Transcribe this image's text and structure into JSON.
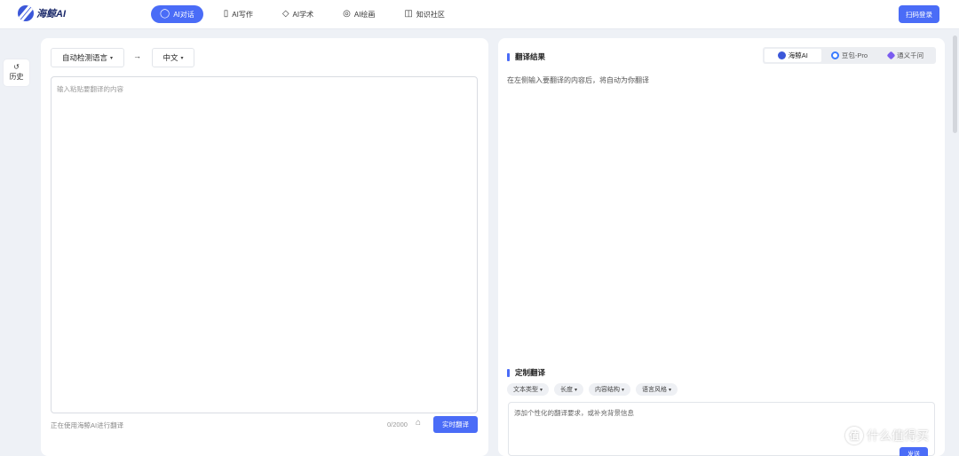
{
  "header": {
    "logo_text": "海鲸AI",
    "nav": [
      {
        "label": "AI对话",
        "icon": "chat-bubble-icon",
        "active": true
      },
      {
        "label": "AI写作",
        "icon": "book-icon",
        "active": false
      },
      {
        "label": "AI学术",
        "icon": "graduation-cap-icon",
        "active": false
      },
      {
        "label": "AI绘画",
        "icon": "palette-icon",
        "active": false
      },
      {
        "label": "知识社区",
        "icon": "layout-icon",
        "active": false
      }
    ],
    "login_label": "扫码登录"
  },
  "sidebar": {
    "history_label": "历史"
  },
  "left": {
    "source_lang": "自动检测语言",
    "target_lang": "中文",
    "arrow": "→",
    "placeholder": "输入粘贴要翻译的内容",
    "footer_note": "正在使用海鲸AI进行翻译",
    "counter": "0/2000",
    "translate_label": "实时翻译"
  },
  "right": {
    "result_title": "翻译结果",
    "engines": [
      {
        "label": "海鲸AI",
        "icon": "haijing-logo-icon",
        "active": true
      },
      {
        "label": "豆包-Pro",
        "icon": "doubao-logo-icon",
        "active": false
      },
      {
        "label": "通义千问",
        "icon": "tongyi-logo-icon",
        "active": false
      }
    ],
    "result_hint": "在左侧输入要翻译的内容后，将自动为你翻译",
    "custom_title": "定制翻译",
    "chips": [
      "文本类型",
      "长度",
      "内容结构",
      "语言风格"
    ],
    "custom_placeholder": "添加个性化的翻译要求，或补充背景信息",
    "send_label": "发送"
  },
  "watermark": {
    "badge": "值",
    "text": "什么值得买"
  },
  "colors": {
    "accent": "#4a6cf7",
    "background": "#eef1f6"
  }
}
